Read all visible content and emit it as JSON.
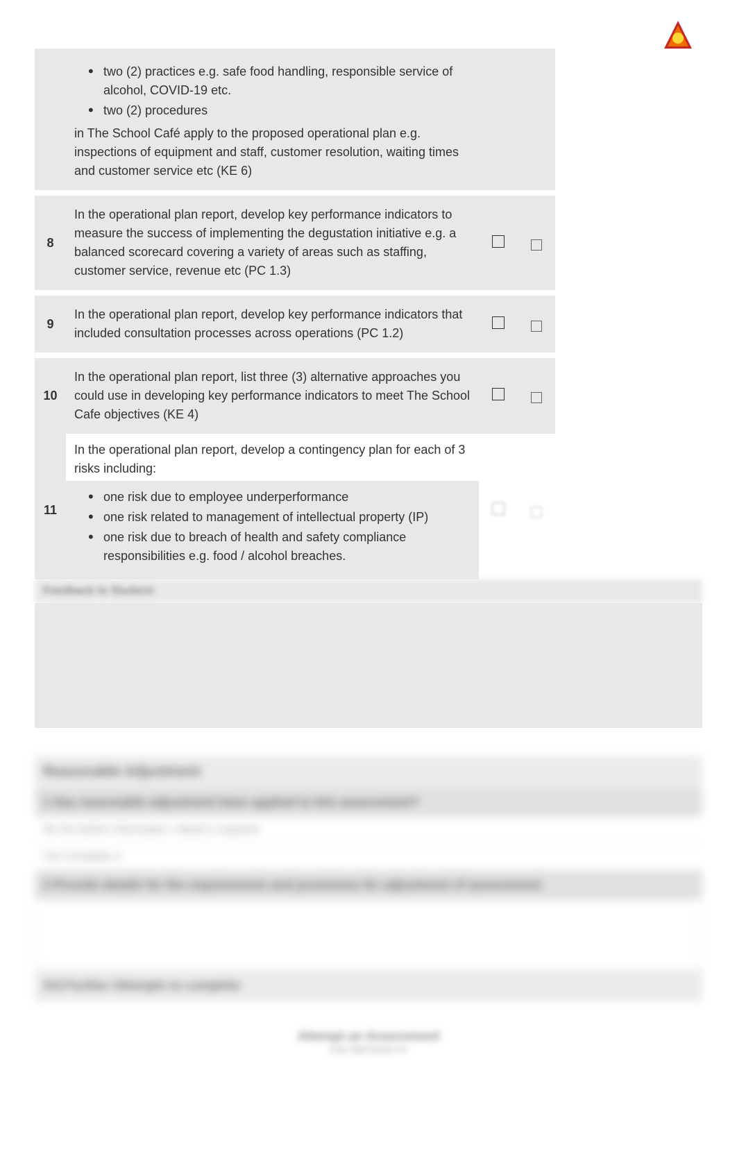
{
  "rows": [
    {
      "num": "",
      "bullets_pre": [
        "two (2) practices e.g. safe food handling, responsible service of alcohol, COVID-19 etc.",
        "two (2) procedures"
      ],
      "text_post": "in The School Café apply to the proposed operational plan e.g. inspections of equipment and staff, customer resolution, waiting times and customer service etc (KE 6)",
      "show_checks": false,
      "blank_right": false
    },
    {
      "num": "8",
      "text": "In the operational plan report, develop key performance indicators to measure the success of implementing the degustation initiative e.g. a balanced scorecard covering a variety of areas such as staffing, customer service, revenue etc (PC 1.3)",
      "show_checks": true,
      "blank_right": true
    },
    {
      "num": "9",
      "text": "In the operational plan report, develop key performance indicators that included consultation processes across operations (PC 1.2)",
      "show_checks": true,
      "blank_right": true
    },
    {
      "num": "10",
      "text": "In the operational plan report, list three (3) alternative approaches you could use in developing key performance indicators to meet The School Cafe objectives (KE 4)",
      "show_checks": true,
      "blank_right": true
    },
    {
      "num": "11",
      "text_pre": "In the operational plan report, develop a contingency plan for each of 3 risks including:",
      "bullets_post": [
        "one risk due to employee underperformance",
        "one risk related to management of intellectual property (IP)",
        "one risk due to breach of health and safety compliance responsibilities e.g. food / alcohol breaches."
      ],
      "show_checks": true,
      "blank_right": true,
      "blurred_checks": true
    }
  ],
  "feedback_label": "Feedback to Student:",
  "blurred": {
    "header": "Reasonable Adjustment",
    "q1": "1   Has reasonable adjustment been applied to this assessment?",
    "opt1": "No     No further information / detail is required",
    "opt2": "Yes    Complete 2",
    "q2": "2   Provide details for the requirements and provisions for adjustment of assessment:",
    "footer": "3rd Further Attempts to complete",
    "bottom1": "Attempt an Assessment",
    "bottom2": "Unit Skill Build #:#"
  }
}
